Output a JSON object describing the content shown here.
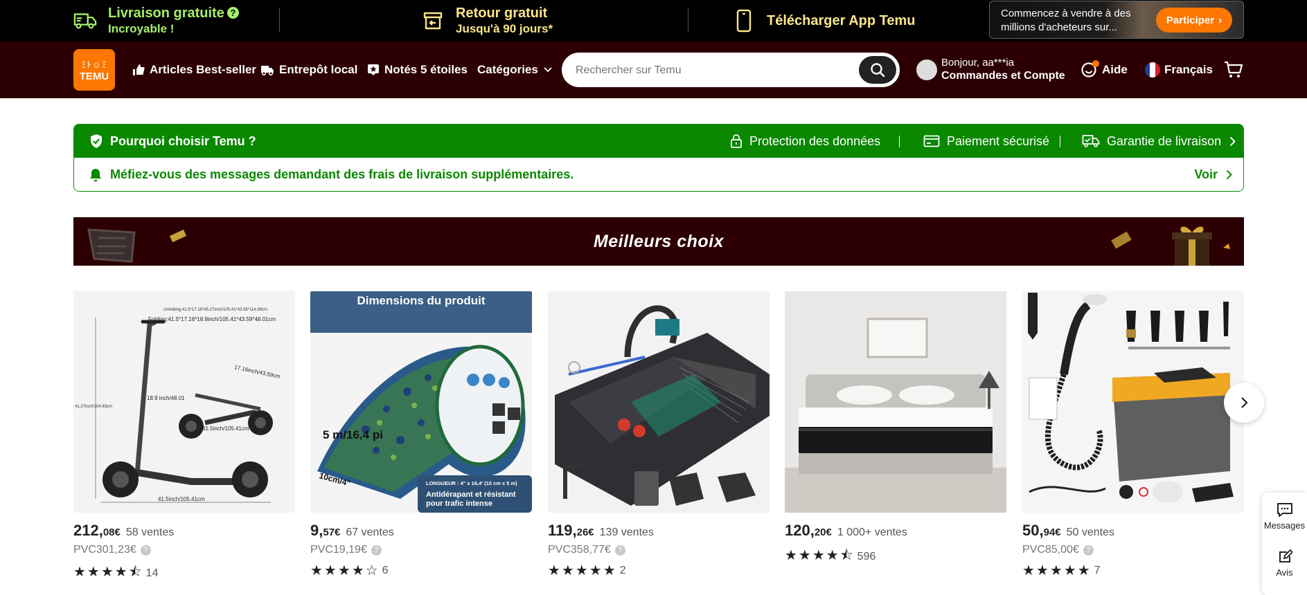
{
  "promo": {
    "shipping_title": "Livraison gratuite",
    "shipping_sub": "Incroyable !",
    "return_title": "Retour gratuit",
    "return_sub": "Jusqu'à 90 jours*",
    "app_title": "Télécharger App Temu",
    "seller_text": "Commencez à vendre à des millions d'acheteurs sur...",
    "seller_button": "Participer",
    "help_glyph": "?"
  },
  "nav": {
    "logo_glyphs": "ﾐﾄ☺ﾐ",
    "logo_word": "TEMU",
    "bestsellers": "Articles Best-seller",
    "warehouse": "Entrepôt local",
    "five_stars": "Notés 5 étoiles",
    "categories": "Catégories",
    "search_placeholder": "Rechercher sur Temu",
    "greeting": "Bonjour, aa***ia",
    "account": "Commandes et Compte",
    "help": "Aide",
    "language": "Français"
  },
  "why": {
    "title": "Pourquoi choisir Temu ?",
    "data_protection": "Protection des données",
    "secure_payment": "Paiement sécurisé",
    "delivery_guarantee": "Garantie de livraison",
    "warning": "Méfiez-vous des messages demandant des frais de livraison supplémentaires.",
    "see": "Voir"
  },
  "banner": {
    "title": "Meilleurs choix"
  },
  "products": [
    {
      "price_int": "212,",
      "price_dec": "08€",
      "sales": "58 ventes",
      "pvc": "PVC301,23€",
      "stars": "★★★★⯪",
      "reviews": "14"
    },
    {
      "price_int": "9,",
      "price_dec": "57€",
      "sales": "67 ventes",
      "pvc": "PVC19,19€",
      "stars": "★★★★☆",
      "reviews": "6"
    },
    {
      "price_int": "119,",
      "price_dec": "26€",
      "sales": "139 ventes",
      "pvc": "PVC358,77€",
      "stars": "★★★★★",
      "reviews": "2"
    },
    {
      "price_int": "120,",
      "price_dec": "20€",
      "sales": "1 000+ ventes",
      "pvc": "",
      "stars": "★★★★⯪",
      "reviews": "596"
    },
    {
      "price_int": "50,",
      "price_dec": "94€",
      "sales": "50 ventes",
      "pvc": "PVC85,00€",
      "stars": "★★★★★",
      "reviews": "7"
    }
  ],
  "product_images": {
    "scooter_dim1": "Folding:41.5*17.16*18.9inch/105.41*43.59*48.01cm",
    "scooter_dim2": "17.16inch/43.59cm",
    "scooter_dim3": "18.9 inch/48.01",
    "scooter_dim4": "41.5inch/105.41cm",
    "tape_header": "Dimensions du produit",
    "tape_length": "5 m/16,4 pi",
    "tape_width": "10cm/4\"",
    "tape_note1": "LONGUEUR : 4\" x 16,4' (10 cm x 5 m)",
    "tape_note2": "Antidérapant et résistant pour trafic intense"
  },
  "side": {
    "messages": "Messages",
    "reviews": "Avis"
  },
  "colors": {
    "accent": "#fb7701",
    "dark_red": "#2c0002",
    "green": "#0a8800",
    "promo_green": "#a6ef6a",
    "promo_yellow": "#fde68a"
  }
}
